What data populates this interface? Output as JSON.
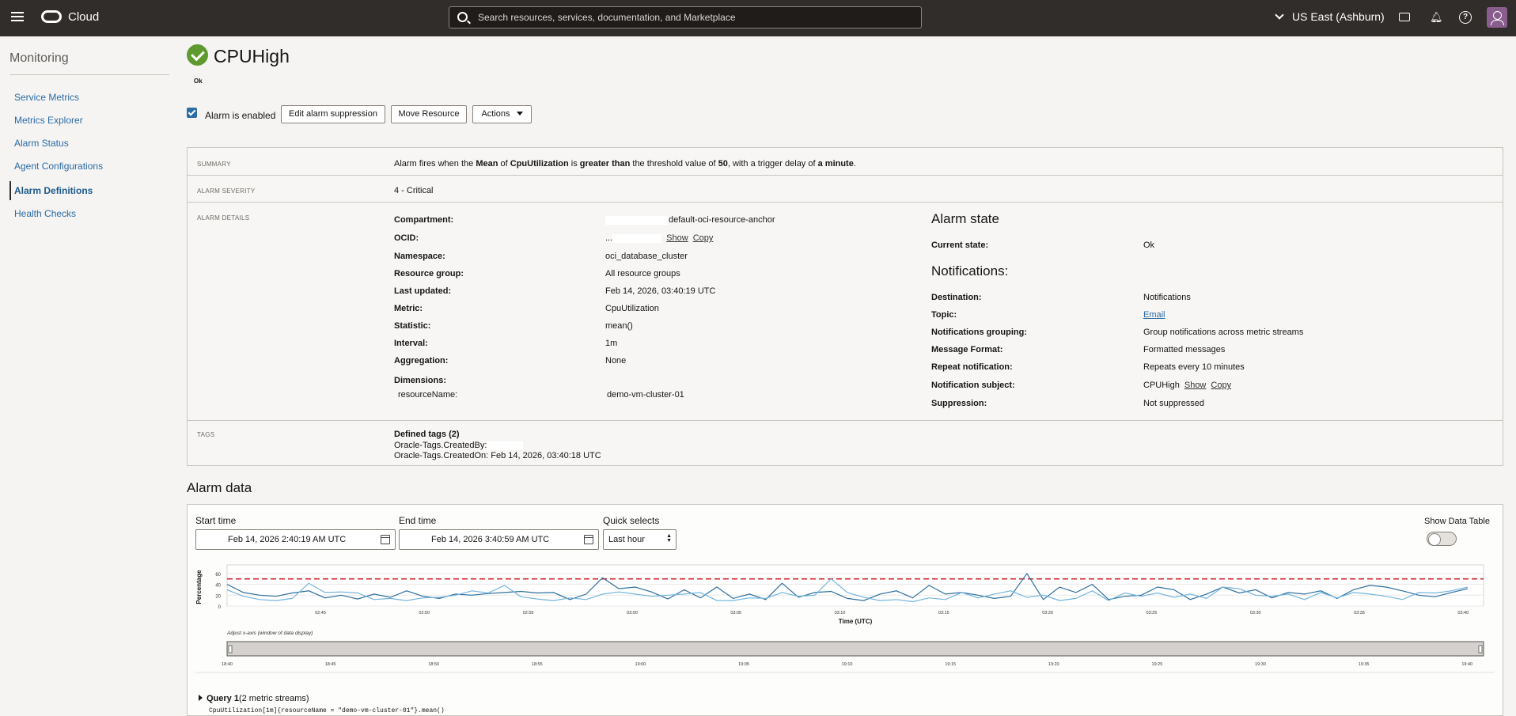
{
  "topbar": {
    "brand": "Cloud",
    "search_placeholder": "Search resources, services, documentation, and Marketplace",
    "region": "US East (Ashburn)"
  },
  "sidebar": {
    "title": "Monitoring",
    "items": [
      {
        "label": "Service Metrics"
      },
      {
        "label": "Metrics Explorer"
      },
      {
        "label": "Alarm Status"
      },
      {
        "label": "Agent Configurations"
      },
      {
        "label": "Alarm Definitions",
        "active": true
      },
      {
        "label": "Health Checks"
      }
    ]
  },
  "header": {
    "title": "CPUHigh",
    "status": "Ok",
    "enabled_label": "Alarm is enabled",
    "buttons": {
      "edit_suppression": "Edit alarm suppression",
      "move_resource": "Move Resource",
      "actions": "Actions"
    }
  },
  "details": {
    "summary_label": "SUMMARY",
    "summary": {
      "p1": "Alarm fires when the ",
      "b1": "Mean",
      "p2": " of ",
      "b2": "CpuUtilization",
      "p3": " is ",
      "b3": "greater than",
      "p4": " the threshold value of ",
      "b4": "50",
      "p5": ", with a trigger delay of ",
      "b5": "a minute",
      "p6": "."
    },
    "severity_label": "ALARM SEVERITY",
    "severity": "4 - Critical",
    "details_label": "ALARM DETAILS",
    "fields": {
      "compartment": {
        "key": "Compartment:",
        "value": "default-oci-resource-anchor"
      },
      "ocid": {
        "key": "OCID:",
        "value": "...",
        "show": "Show",
        "copy": "Copy"
      },
      "namespace": {
        "key": "Namespace:",
        "value": "oci_database_cluster"
      },
      "resource_group": {
        "key": "Resource group:",
        "value": "All resource groups"
      },
      "last_updated": {
        "key": "Last updated:",
        "value": "Feb 14, 2026, 03:40:19 UTC"
      },
      "metric": {
        "key": "Metric:",
        "value": "CpuUtilization"
      },
      "statistic": {
        "key": "Statistic:",
        "value": "mean()"
      },
      "interval": {
        "key": "Interval:",
        "value": "1m"
      },
      "aggregation": {
        "key": "Aggregation:",
        "value": "None"
      },
      "dimensions": {
        "key": "Dimensions:"
      },
      "resource_name": {
        "key": "resourceName:",
        "value": "demo-vm-cluster-01"
      }
    },
    "alarm_state": {
      "heading": "Alarm state",
      "current_state": {
        "key": "Current state:",
        "value": "Ok"
      }
    },
    "notifications": {
      "heading": "Notifications:",
      "destination": {
        "key": "Destination:",
        "value": "Notifications"
      },
      "topic": {
        "key": "Topic:",
        "value": "Email"
      },
      "grouping": {
        "key": "Notifications grouping:",
        "value": "Group notifications across metric streams"
      },
      "format": {
        "key": "Message Format:",
        "value": "Formatted messages"
      },
      "repeat": {
        "key": "Repeat notification:",
        "value": "Repeats every 10 minutes"
      },
      "subject": {
        "key": "Notification subject:",
        "value": "CPUHigh",
        "show": "Show",
        "copy": "Copy"
      },
      "suppression": {
        "key": "Suppression:",
        "value": "Not suppressed"
      }
    },
    "tags_label": "TAGS",
    "tags": {
      "heading": "Defined tags (2)",
      "created_by": "Oracle-Tags.CreatedBy:",
      "created_on": "Oracle-Tags.CreatedOn: Feb 14, 2026, 03:40:18 UTC"
    }
  },
  "alarm_data": {
    "title": "Alarm data",
    "start_label": "Start time",
    "start_value": "Feb 14, 2026 2:40:19 AM UTC",
    "end_label": "End time",
    "end_value": "Feb 14, 2026 3:40:59 AM UTC",
    "quick_label": "Quick selects",
    "quick_value": "Last hour",
    "show_table_label": "Show Data Table",
    "adjust_label": "Adjust x-axis (window of data display)",
    "query_title": "Query 1",
    "query_streams": "(2 metric streams)",
    "query_text": "CpuUtilization[1m]{resourceName = \"demo-vm-cluster-01\"}.mean()"
  },
  "chart_data": {
    "type": "line",
    "ylabel": "Percentage",
    "xlabel": "Time (UTC)",
    "ylim": [
      0,
      70
    ],
    "yticks": [
      0,
      20,
      40,
      60
    ],
    "xtick_labels": [
      "02:45",
      "02:50",
      "02:55",
      "03:00",
      "03:05",
      "03:10",
      "03:15",
      "03:20",
      "03:25",
      "03:30",
      "03:35",
      "03:40"
    ],
    "threshold": 50,
    "colors": {
      "series1": "#2e6f9e",
      "series2": "#74b5dd",
      "threshold": "#d0262b"
    },
    "series": [
      {
        "values": [
          40,
          25,
          20,
          18,
          24,
          28,
          15,
          20,
          13,
          22,
          16,
          28,
          18,
          14,
          22,
          20,
          23,
          25,
          27,
          24,
          25,
          12,
          22,
          52,
          32,
          35,
          26,
          13,
          30,
          15,
          35,
          14,
          22,
          12,
          42,
          16,
          25,
          27,
          14,
          10,
          22,
          28,
          15,
          38,
          22,
          25,
          20,
          14,
          18,
          60,
          12,
          35,
          25,
          40,
          12,
          18,
          20,
          35,
          30,
          12,
          22,
          35,
          24,
          30,
          15,
          25,
          22,
          28,
          14,
          30,
          38,
          35,
          28,
          20,
          17,
          25,
          32
        ]
      },
      {
        "values": [
          30,
          18,
          12,
          10,
          14,
          42,
          25,
          26,
          24,
          12,
          14,
          10,
          15,
          16,
          20,
          28,
          24,
          38,
          17,
          13,
          10,
          15,
          12,
          22,
          26,
          22,
          18,
          20,
          22,
          25,
          10,
          10,
          15,
          14,
          25,
          18,
          20,
          50,
          25,
          16,
          10,
          12,
          8,
          15,
          12,
          25,
          15,
          22,
          28,
          16,
          20,
          10,
          14,
          28,
          10,
          24,
          18,
          24,
          16,
          22,
          14,
          35,
          32,
          20,
          18,
          22,
          12,
          25,
          15,
          25,
          22,
          18,
          12,
          25,
          24,
          28,
          35
        ]
      }
    ],
    "nav_tick_labels": [
      "18:40",
      "18:45",
      "18:50",
      "18:55",
      "19:00",
      "19:05",
      "19:10",
      "19:15",
      "19:20",
      "19:25",
      "19:30",
      "19:35",
      "19:40"
    ]
  }
}
